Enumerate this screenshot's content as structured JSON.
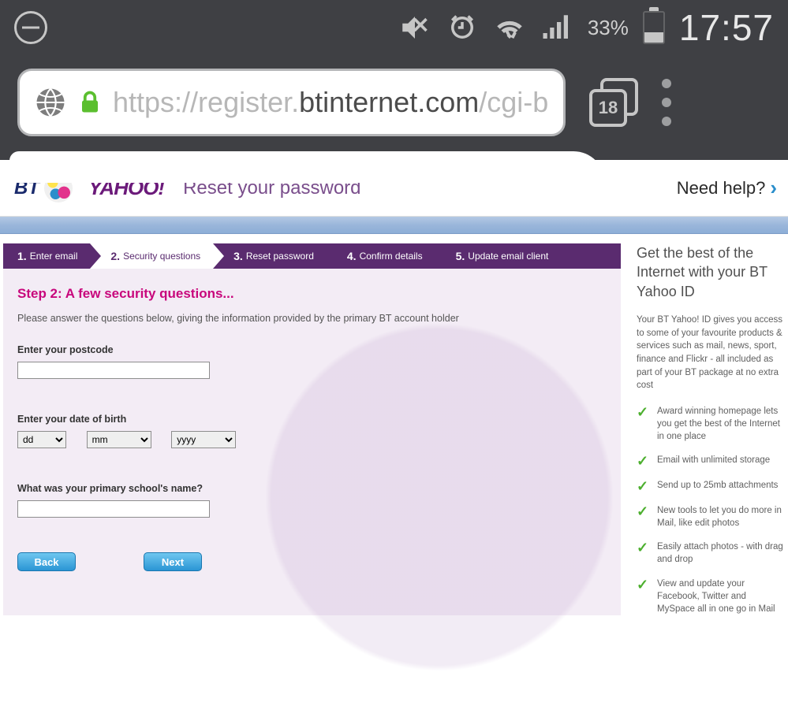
{
  "status": {
    "time": "17:57",
    "battery_pct": "33%",
    "tabs_count": "18"
  },
  "url": {
    "prefix1": "https://register.",
    "domain": "btinternet.com",
    "suffix": "/cgi-b"
  },
  "header": {
    "bt": "BT",
    "yahoo": "YAHOO!",
    "title": "Reset your password",
    "help": "Need help?"
  },
  "steps": {
    "s1_num": "1.",
    "s1": "Enter email",
    "s2_num": "2.",
    "s2": "Security questions",
    "s3_num": "3.",
    "s3": "Reset password",
    "s4_num": "4.",
    "s4": "Confirm details",
    "s5_num": "5.",
    "s5": "Update email client"
  },
  "form": {
    "title": "Step 2: A few security questions...",
    "intro": "Please answer the questions below, giving the information provided by the primary BT account holder",
    "postcode_label": "Enter your postcode",
    "dob_label": "Enter your date of birth",
    "dd": "dd",
    "mm": "mm",
    "yy": "yyyy",
    "school_label": "What was your primary school's name?",
    "back": "Back",
    "next": "Next"
  },
  "sidebar": {
    "heading": "Get the best of the Internet with your BT Yahoo ID",
    "blurb": "Your BT Yahoo! ID gives you access to some of your favourite products & services such as mail, news, sport, finance and Flickr - all included as part of your BT package at no extra cost",
    "items": {
      "0": "Award winning homepage lets you get the best of the Internet in one place",
      "1": "Email with unlimited storage",
      "2": "Send up to 25mb attachments",
      "3": "New tools to let you do more in Mail, like edit photos",
      "4": "Easily attach photos - with drag and drop",
      "5": "View and update your Facebook, Twitter and MySpace all in one go in Mail"
    }
  }
}
